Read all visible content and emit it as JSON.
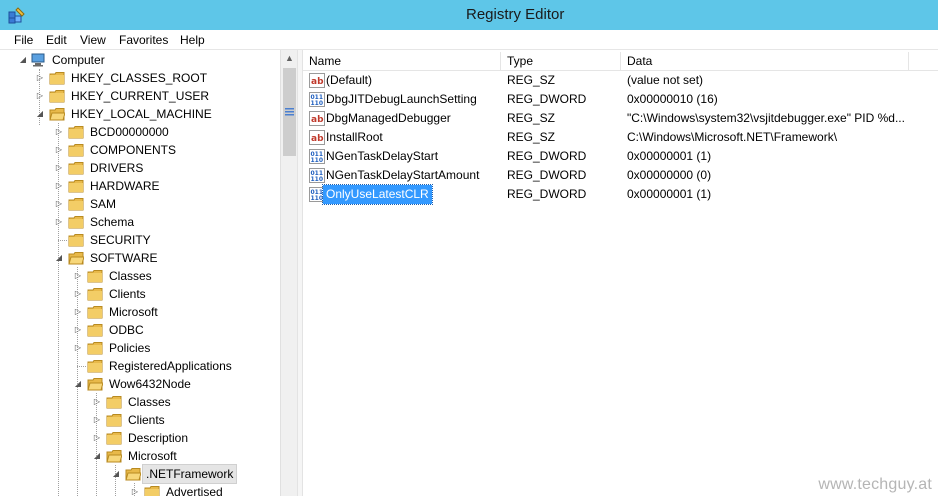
{
  "window": {
    "title": "Registry Editor"
  },
  "menu": [
    "File",
    "Edit",
    "View",
    "Favorites",
    "Help"
  ],
  "tree": {
    "root": "Computer",
    "hives": [
      "HKEY_CLASSES_ROOT",
      "HKEY_CURRENT_USER",
      "HKEY_LOCAL_MACHINE"
    ],
    "hklm_children": [
      "BCD00000000",
      "COMPONENTS",
      "DRIVERS",
      "HARDWARE",
      "SAM",
      "Schema",
      "SECURITY",
      "SOFTWARE"
    ],
    "software_children": [
      "Classes",
      "Clients",
      "Microsoft",
      "ODBC",
      "Policies",
      "RegisteredApplications",
      "Wow6432Node"
    ],
    "wow_children": [
      "Classes",
      "Clients",
      "Description",
      "Microsoft"
    ],
    "microsoft_children": [
      ".NETFramework"
    ],
    "netfx_children": [
      "Advertised"
    ]
  },
  "list": {
    "columns": [
      "Name",
      "Type",
      "Data"
    ],
    "rows": [
      {
        "icon": "string-value-icon",
        "name": "(Default)",
        "type": "REG_SZ",
        "data": "(value not set)"
      },
      {
        "icon": "dword-value-icon",
        "name": "DbgJITDebugLaunchSetting",
        "type": "REG_DWORD",
        "data": "0x00000010 (16)"
      },
      {
        "icon": "string-value-icon",
        "name": "DbgManagedDebugger",
        "type": "REG_SZ",
        "data": "\"C:\\Windows\\system32\\vsjitdebugger.exe\" PID %d..."
      },
      {
        "icon": "string-value-icon",
        "name": "InstallRoot",
        "type": "REG_SZ",
        "data": "C:\\Windows\\Microsoft.NET\\Framework\\"
      },
      {
        "icon": "dword-value-icon",
        "name": "NGenTaskDelayStart",
        "type": "REG_DWORD",
        "data": "0x00000001 (1)"
      },
      {
        "icon": "dword-value-icon",
        "name": "NGenTaskDelayStartAmount",
        "type": "REG_DWORD",
        "data": "0x00000000 (0)"
      },
      {
        "icon": "dword-value-icon",
        "name": "OnlyUseLatestCLR",
        "type": "REG_DWORD",
        "data": "0x00000001 (1)"
      }
    ]
  },
  "watermark": "www.techguy.at",
  "colors": {
    "titlebar": "#5ec6e8",
    "selection": "#3399ff",
    "folder": "#e8b94a"
  }
}
